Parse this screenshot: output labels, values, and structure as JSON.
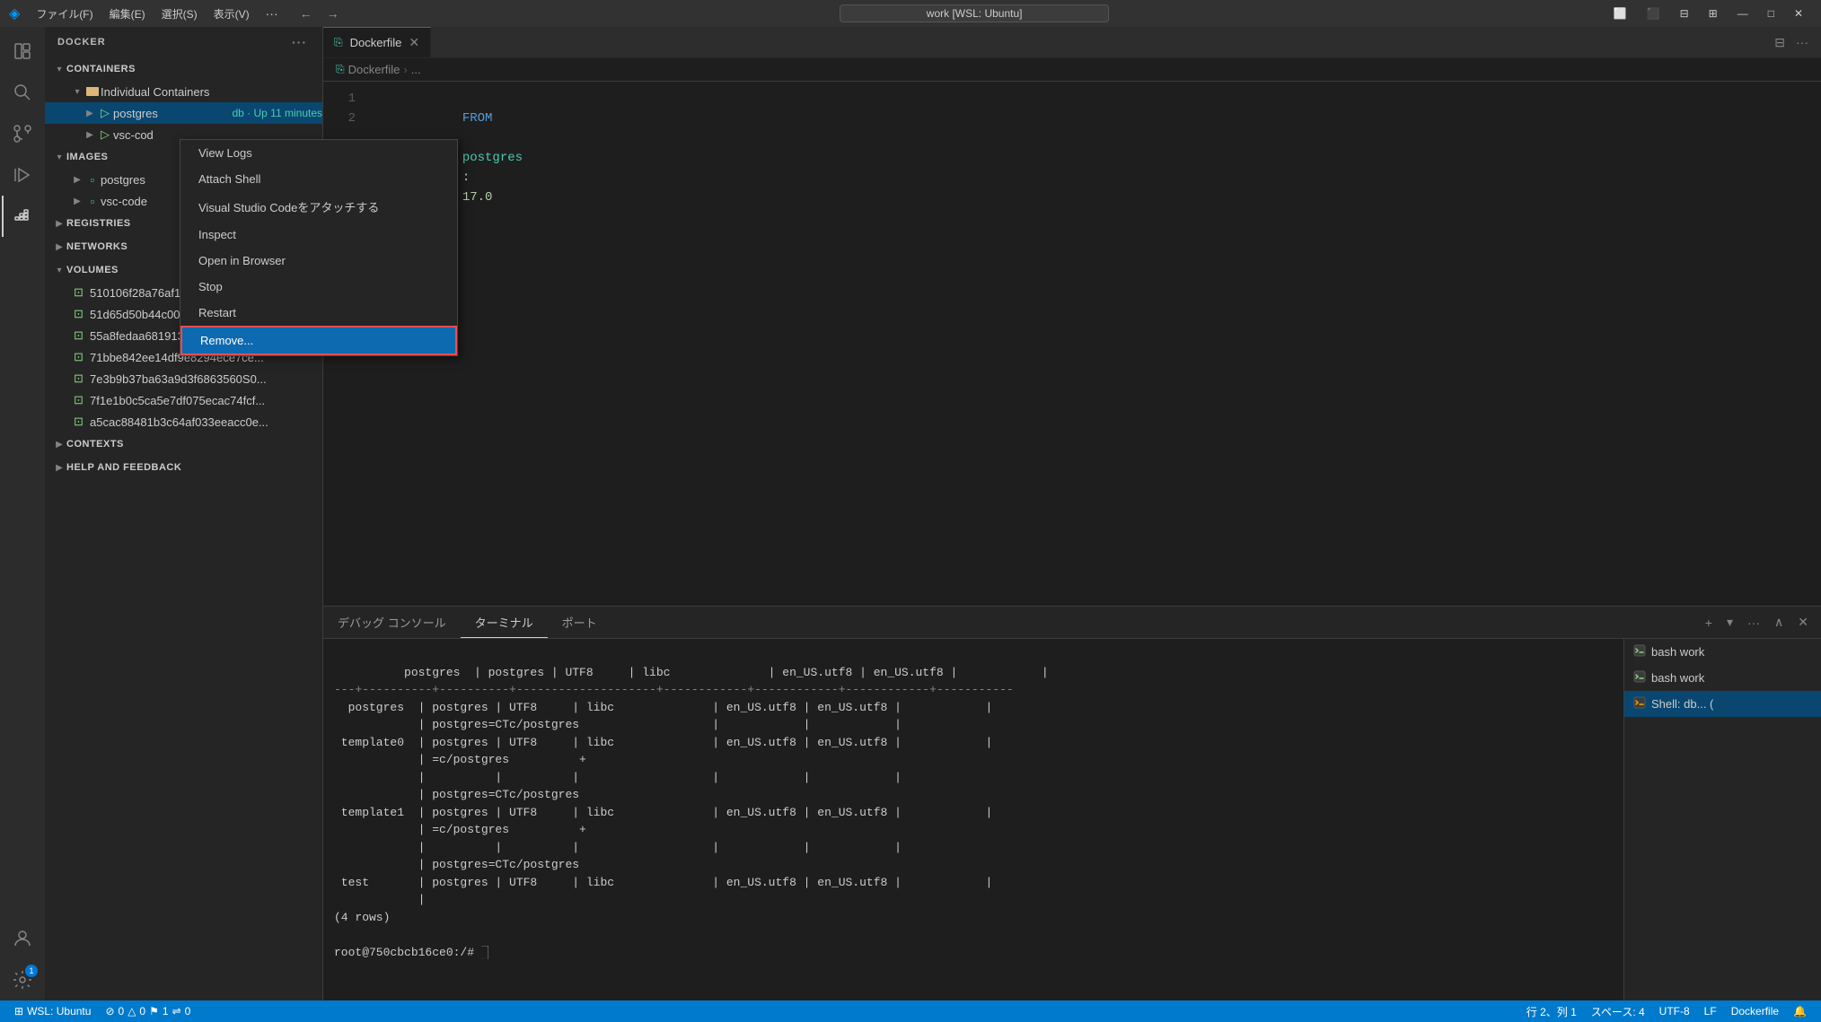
{
  "titlebar": {
    "logo": "◈",
    "menus": [
      "ファイル(F)",
      "編集(E)",
      "選択(S)",
      "表示(V)",
      "..."
    ],
    "search_value": "work [WSL: Ubuntu]",
    "back_btn": "←",
    "forward_btn": "→",
    "controls": [
      "□□",
      "⧉",
      "—",
      "□",
      "✕"
    ]
  },
  "activity_bar": {
    "icons": [
      "⊞",
      "🔍",
      "⑂",
      "▷",
      "⊡",
      "⛵",
      "⚙"
    ],
    "badge_index": 5,
    "badge_value": "1",
    "bottom_badge": "1"
  },
  "sidebar": {
    "title": "DOCKER",
    "containers_label": "CONTAINERS",
    "individual_containers_label": "Individual Containers",
    "postgres_label": "postgres",
    "postgres_status": "db · Up 11 minutes",
    "vsc_code_label": "vsc-cod",
    "images_label": "IMAGES",
    "images_item1": "postgres",
    "images_item2": "vsc-code",
    "registries_label": "REGISTRIES",
    "networks_label": "NETWORKS",
    "volumes_label": "VOLUMES",
    "volumes": [
      "510106f28a76af11b6f4f841a5ec...",
      "51d65d50b44c00063e5f23ef84c...",
      "55a8fedaa681913276147ab9e4...",
      "71bbe842ee14df9e8294ece7ce...",
      "7e3b9b37ba63a9d3f6863560S0...",
      "7f1e1b0c5ca5e7df075ecac74fcf...",
      "a5cac88481b3c64af033eeacc0e..."
    ],
    "contexts_label": "CONTEXTS",
    "help_label": "HELP AND FEEDBACK"
  },
  "context_menu": {
    "items": [
      "View Logs",
      "Attach Shell",
      "Visual Studio Codeをアタッチする",
      "Inspect",
      "Open in Browser",
      "Stop",
      "Restart",
      "Remove..."
    ],
    "highlighted_index": 7
  },
  "editor": {
    "tab_label": "Dockerfile",
    "breadcrumb_file": "Dockerfile",
    "breadcrumb_sep": "...",
    "code_lines": [
      {
        "num": "1",
        "content": "FROM postgres:17.0"
      },
      {
        "num": "2",
        "content": ""
      }
    ]
  },
  "terminal": {
    "tabs": [
      "デバッグ コンソール",
      "ターミナル",
      "ポート"
    ],
    "active_tab": "ターミナル",
    "content_lines": [
      "          postgres=CTc/postgres                       |                |",
      " template0 | postgres | UTF8     | libc              | en_US.utf8 | en_US.utf8 |            |",
      "           | =c/postgres          +",
      "           |          |          |                   |            |            |",
      "           | postgres=CTc/postgres",
      " template1 | postgres | UTF8     | libc              | en_US.utf8 | en_US.utf8 |            |",
      "           | =c/postgres          +",
      "           |          |          |                   |            |            |",
      "           | postgres=CTc/postgres",
      " test      | postgres | UTF8     | libc              | en_US.utf8 | en_US.utf8 |            |",
      "           |",
      "(4 rows)",
      "",
      "root@750cbcb16ce0:/#  "
    ],
    "instances": [
      {
        "label": "bash  work",
        "type": "bash"
      },
      {
        "label": "bash  work",
        "type": "bash"
      },
      {
        "label": "Shell: db... (",
        "type": "shell"
      }
    ]
  },
  "status_bar": {
    "wsl_label": "WSL: Ubuntu",
    "errors": "⊘ 0",
    "warnings": "△ 0",
    "info": "⚑ 1",
    "ports": "⇌ 0",
    "line_col": "行 2、列 1",
    "spaces": "スペース: 4",
    "encoding": "UTF-8",
    "eol": "LF",
    "language": "Dockerfile",
    "bell": "🔔"
  }
}
